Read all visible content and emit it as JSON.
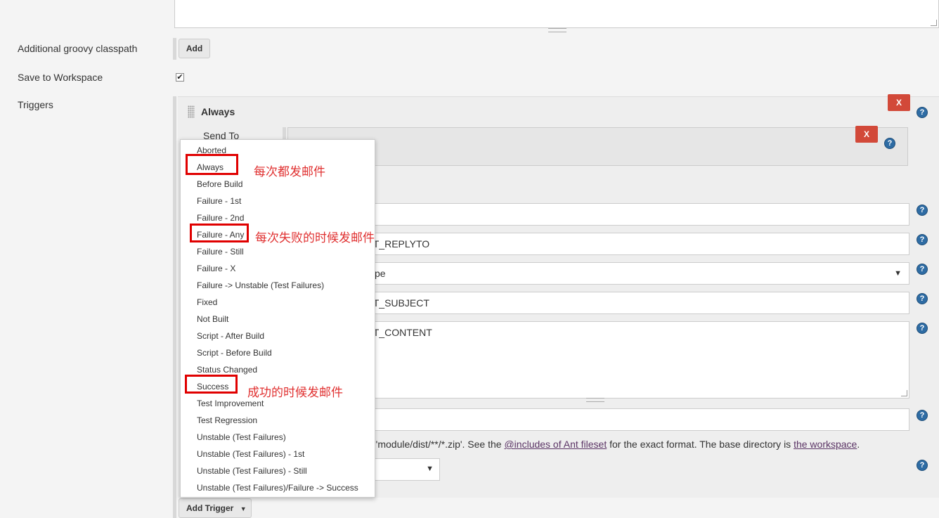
{
  "left_labels": {
    "additional_groovy_classpath": "Additional groovy classpath",
    "save_to_workspace": "Save to Workspace",
    "triggers": "Triggers"
  },
  "buttons": {
    "add": "Add",
    "remove_x": "X",
    "add_trigger": "Add Trigger"
  },
  "save_to_workspace_checked": true,
  "trigger": {
    "title": "Always",
    "send_to_label": "Send To"
  },
  "fields": {
    "reply_to_value": "LT_REPLYTO",
    "content_type_value": "pe",
    "subject_value": "LT_SUBJECT",
    "content_value": "LT_CONTENT"
  },
  "attachments_help": {
    "prefix": "e 'module/dist/**/*.zip'. See the ",
    "link1": "@includes of Ant fileset",
    "middle": " for the exact format. The base directory is ",
    "link2": "the workspace",
    "suffix": "."
  },
  "dropdown_items": [
    "Aborted",
    "Always",
    "Before Build",
    "Failure - 1st",
    "Failure - 2nd",
    "Failure - Any",
    "Failure - Still",
    "Failure - X",
    "Failure -> Unstable (Test Failures)",
    "Fixed",
    "Not Built",
    "Script - After Build",
    "Script - Before Build",
    "Status Changed",
    "Success",
    "Test Improvement",
    "Test Regression",
    "Unstable (Test Failures)",
    "Unstable (Test Failures) - 1st",
    "Unstable (Test Failures) - Still",
    "Unstable (Test Failures)/Failure -> Success"
  ],
  "annotations": {
    "always_note": "每次都发邮件",
    "failure_any_note": "每次失败的时候发邮件",
    "success_note": "成功的时候发邮件"
  },
  "colors": {
    "remove_button": "#d24939",
    "help_icon": "#2e6ca4",
    "annotation": "#e00000"
  }
}
